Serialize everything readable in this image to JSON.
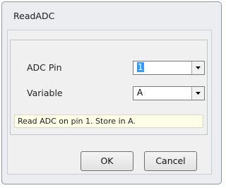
{
  "window": {
    "title": "ReadADC"
  },
  "form": {
    "adc_pin": {
      "label": "ADC Pin",
      "value": "1"
    },
    "variable": {
      "label": "Variable",
      "value": "A"
    }
  },
  "status": "Read ADC on pin 1. Store in A.",
  "buttons": {
    "ok": "OK",
    "cancel": "Cancel"
  }
}
